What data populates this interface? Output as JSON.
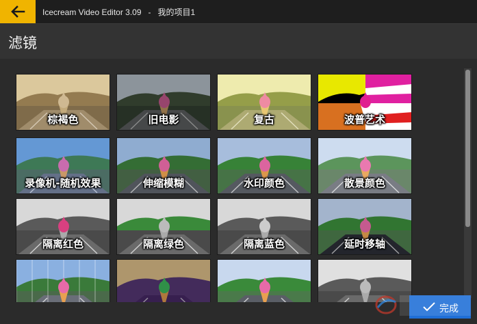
{
  "window": {
    "title": "Icecream Video Editor 3.09   -   我的项目1"
  },
  "header": {
    "title": "滤镜"
  },
  "filters": [
    {
      "label": "棕褐色",
      "style": "sepia"
    },
    {
      "label": "旧电影",
      "style": "oldfilm"
    },
    {
      "label": "复古",
      "style": "retro"
    },
    {
      "label": "波普艺术",
      "style": "popart"
    },
    {
      "label": "录像机-随机效果",
      "style": "vhs"
    },
    {
      "label": "伸缩模糊",
      "style": "blur"
    },
    {
      "label": "水印颜色",
      "style": "watercolor"
    },
    {
      "label": "散景颜色",
      "style": "bokeh"
    },
    {
      "label": "隔离红色",
      "style": "isored"
    },
    {
      "label": "隔离绿色",
      "style": "isogreen"
    },
    {
      "label": "隔离蓝色",
      "style": "isoblue"
    },
    {
      "label": "延时移轴",
      "style": "tiltshift"
    },
    {
      "label": "",
      "style": "mosaic"
    },
    {
      "label": "",
      "style": "vignette"
    },
    {
      "label": "",
      "style": "normal"
    },
    {
      "label": "",
      "style": "gray"
    }
  ],
  "actions": {
    "done_label": "完成"
  },
  "colors": {
    "accent_back": "#f0b400",
    "accent_done": "#1f6fd6"
  },
  "icons": {
    "back": "arrow-left-icon",
    "done": "checkmark-icon"
  }
}
